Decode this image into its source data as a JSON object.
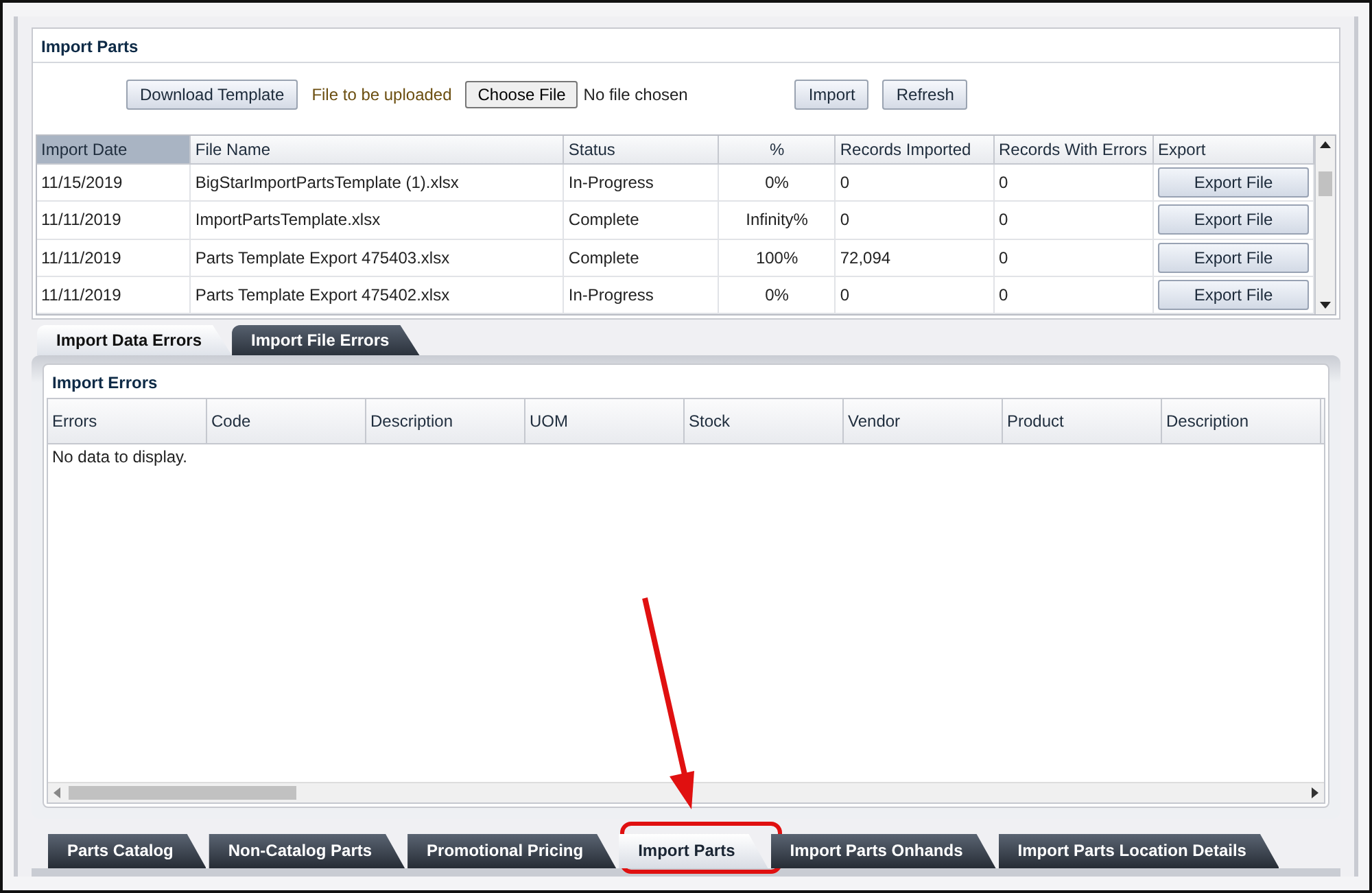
{
  "panel": {
    "title": "Import Parts"
  },
  "toolbar": {
    "download_button": "Download Template",
    "upload_label": "File to be uploaded",
    "choose_button": "Choose File",
    "file_status": "No file chosen",
    "import_button": "Import",
    "refresh_button": "Refresh"
  },
  "imports_table": {
    "columns": [
      {
        "label": "Import Date",
        "selected": true
      },
      {
        "label": "File Name",
        "selected": false
      },
      {
        "label": "Status",
        "selected": false
      },
      {
        "label": "%",
        "selected": false
      },
      {
        "label": "Records Imported",
        "selected": false
      },
      {
        "label": "Records With Errors",
        "selected": false
      },
      {
        "label": "Export",
        "selected": false
      }
    ],
    "rows": [
      {
        "date": "11/15/2019",
        "file": "BigStarImportPartsTemplate (1).xlsx",
        "status": "In-Progress",
        "percent": "0%",
        "imported": "0",
        "errors": "0",
        "export": "Export File"
      },
      {
        "date": "11/11/2019",
        "file": "ImportPartsTemplate.xlsx",
        "status": "Complete",
        "percent": "Infinity%",
        "imported": "0",
        "errors": "0",
        "export": "Export File"
      },
      {
        "date": "11/11/2019",
        "file": "Parts Template Export 475403.xlsx",
        "status": "Complete",
        "percent": "100%",
        "imported": "72,094",
        "errors": "0",
        "export": "Export File"
      },
      {
        "date": "11/11/2019",
        "file": "Parts Template Export 475402.xlsx",
        "status": "In-Progress",
        "percent": "0%",
        "imported": "0",
        "errors": "0",
        "export": "Export File"
      }
    ]
  },
  "error_tabs": [
    {
      "label": "Import Data Errors",
      "selected": true
    },
    {
      "label": "Import File Errors",
      "selected": false
    }
  ],
  "errors_panel": {
    "title": "Import Errors",
    "columns": [
      "Errors",
      "Code",
      "Description",
      "UOM",
      "Stock",
      "Vendor",
      "Product",
      "Description"
    ],
    "empty_message": "No data to display."
  },
  "bottom_tabs": [
    {
      "label": "Parts Catalog",
      "selected": false
    },
    {
      "label": "Non-Catalog Parts",
      "selected": false
    },
    {
      "label": "Promotional Pricing",
      "selected": false
    },
    {
      "label": "Import Parts",
      "selected": true
    },
    {
      "label": "Import Parts Onhands",
      "selected": false
    },
    {
      "label": "Import Parts Location Details",
      "selected": false
    }
  ]
}
